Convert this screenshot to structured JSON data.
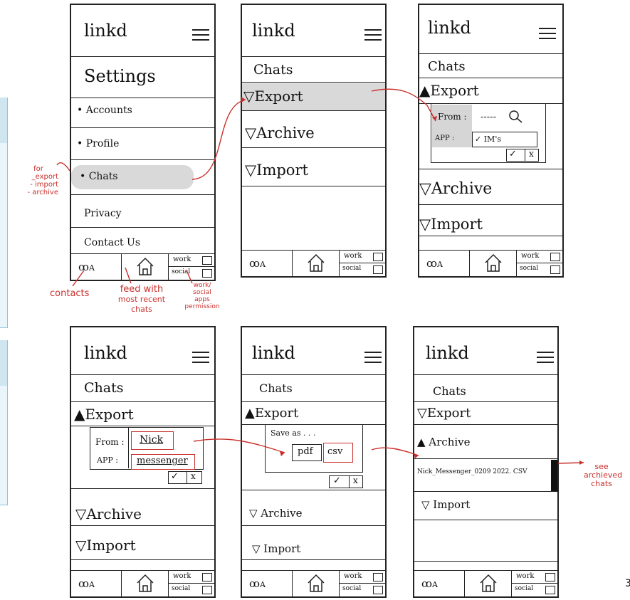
{
  "colors": {
    "annotation": "#c9302c",
    "highlight": "#d9d9d9",
    "panel": "#cfe6f1"
  },
  "app": {
    "logo": "linkd"
  },
  "bottom_nav": {
    "contacts_icon": "people-icon",
    "home_icon": "home-icon",
    "work": "work",
    "social": "social"
  },
  "screen1": {
    "title": "Settings",
    "items": [
      "• Accounts",
      "• Profile",
      "• Chats",
      "Privacy",
      "Contact Us"
    ]
  },
  "screen2": {
    "title": "Chats",
    "export": "▽Export",
    "archive": "▽Archive",
    "import": "▽Import"
  },
  "screen3": {
    "title": "Chats",
    "export": "▲Export",
    "from_label": "From :",
    "from_value": "-----",
    "app_label": "APP :",
    "app_value": "✓ IM's",
    "archive": "▽Archive",
    "import": "▽Import"
  },
  "screen4": {
    "title": "Chats",
    "export": "▲Export",
    "from_label": "From :",
    "from_value": "Nick",
    "app_label": "APP :",
    "app_value": "messenger",
    "archive": "▽Archive",
    "import": "▽Import"
  },
  "screen5": {
    "title": "Chats",
    "export": "▲Export",
    "save_as": "Save as . . .",
    "pdf": "pdf",
    "csv": "csv",
    "archive": "▽ Archive",
    "import": "▽ Import"
  },
  "screen6": {
    "title": "Chats",
    "export": "▽Export",
    "archive": "▲ Archive",
    "file": "Nick_Messenger_0209 2022. CSV",
    "import": "▽ Import"
  },
  "annotations": {
    "chats_note": [
      "for",
      "_export",
      "- import",
      "- archive"
    ],
    "contacts": "contacts",
    "feed": [
      "feed with",
      "most recent",
      "chats"
    ],
    "work_social": [
      "work/",
      "social",
      "apps",
      "permission"
    ],
    "see_archived": [
      "see",
      "archieved",
      "chats"
    ]
  },
  "page_marker": "3"
}
